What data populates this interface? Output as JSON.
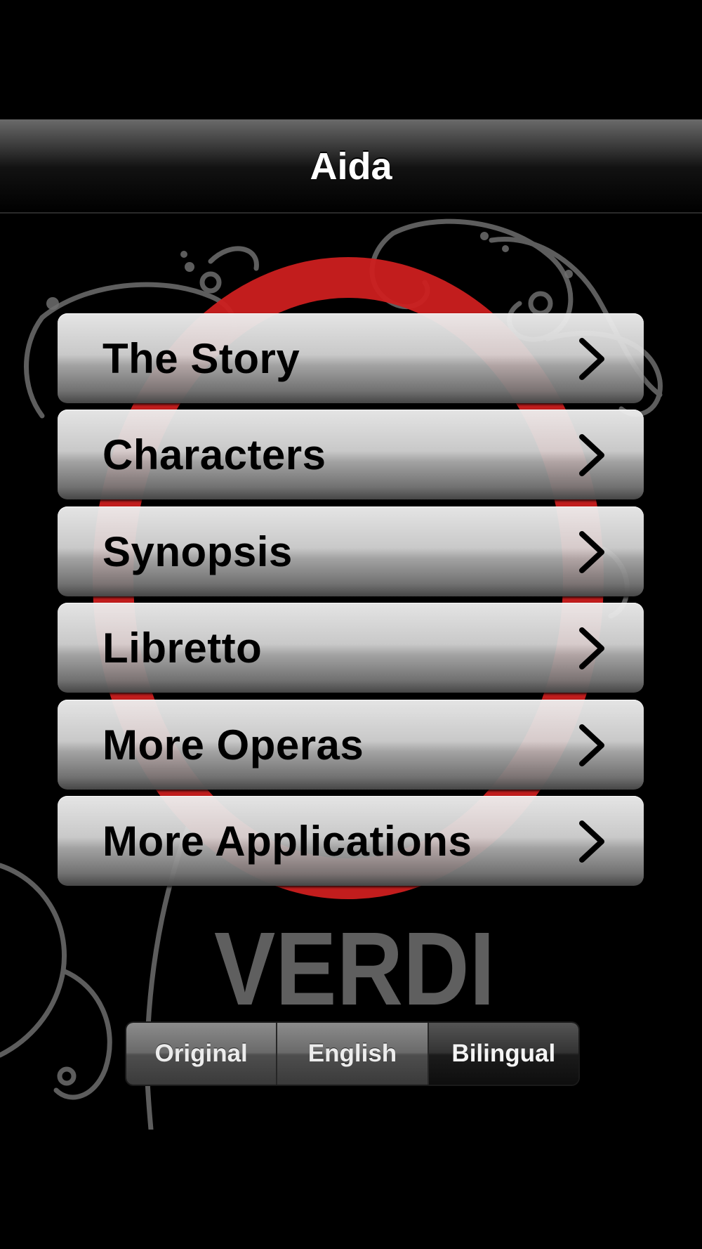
{
  "navbar": {
    "title": "Aida"
  },
  "menu": {
    "items": [
      {
        "label": "The Story",
        "icon": "chevron-right-icon"
      },
      {
        "label": "Characters",
        "icon": "chevron-right-icon"
      },
      {
        "label": "Synopsis",
        "icon": "chevron-right-icon"
      },
      {
        "label": "Libretto",
        "icon": "chevron-right-icon"
      },
      {
        "label": "More Operas",
        "icon": "chevron-right-icon"
      },
      {
        "label": "More Applications",
        "icon": "chevron-right-icon"
      }
    ]
  },
  "branding": {
    "wordmark": "VERDI"
  },
  "language_selector": {
    "options": [
      "Original",
      "English",
      "Bilingual"
    ],
    "selected": "Bilingual"
  },
  "colors": {
    "background": "#000000",
    "accent_red": "#cc1f1f",
    "ornament": "#6e6e6e",
    "wordmark": "#5f5f5f"
  }
}
